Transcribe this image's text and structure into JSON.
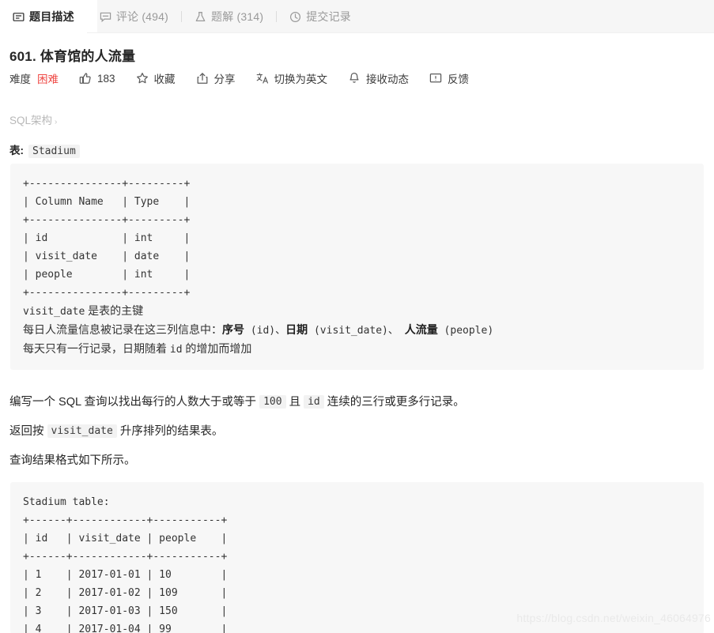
{
  "tabs": [
    {
      "id": "description",
      "label": "题目描述",
      "count": "",
      "icon": "description-icon",
      "active": true
    },
    {
      "id": "comments",
      "label": "评论",
      "count": "(494)",
      "icon": "comment-icon",
      "active": false
    },
    {
      "id": "solutions",
      "label": "题解",
      "count": "(314)",
      "icon": "flask-icon",
      "active": false
    },
    {
      "id": "submissions",
      "label": "提交记录",
      "count": "",
      "icon": "clock-icon",
      "active": false
    }
  ],
  "problem": {
    "title": "601. 体育馆的人流量",
    "difficulty_label": "难度",
    "difficulty_value": "困难",
    "difficulty_color": "#ef4743"
  },
  "meta_actions": [
    {
      "id": "like",
      "icon": "thumbs-up-icon",
      "label": "183"
    },
    {
      "id": "favorite",
      "icon": "star-icon",
      "label": "收藏"
    },
    {
      "id": "share",
      "icon": "share-icon",
      "label": "分享"
    },
    {
      "id": "translate",
      "icon": "translate-icon",
      "label": "切换为英文"
    },
    {
      "id": "subscribe",
      "icon": "bell-icon",
      "label": "接收动态"
    },
    {
      "id": "feedback",
      "icon": "feedback-icon",
      "label": "反馈"
    }
  ],
  "schema_link": {
    "label": "SQL架构",
    "chevron": "›"
  },
  "table_label": {
    "prefix": "表:",
    "name": "Stadium"
  },
  "schema_code": {
    "ascii": "+---------------+---------+\n| Column Name   | Type    |\n+---------------+---------+\n| id            | int     |\n| visit_date    | date    |\n| people        | int     |\n+---------------+---------+",
    "note_primary_key_code": "visit_date",
    "note_primary_key_text": " 是表的主键",
    "note_line2_a": "每日人流量信息被记录在这三列信息中：",
    "note_line2_b1": "序号",
    "note_line2_c1": " (id)、",
    "note_line2_b2": "日期",
    "note_line2_c2": " (visit_date)、 ",
    "note_line2_b3": "人流量",
    "note_line2_c3": " (people)",
    "note_line3_a": "每天只有一行记录，日期随着 ",
    "note_line3_code": "id",
    "note_line3_b": " 的增加而增加"
  },
  "body": {
    "p1_a": "编写一个 SQL 查询以找出每行的人数大于或等于 ",
    "p1_code1": "100",
    "p1_b": " 且 ",
    "p1_code2": "id",
    "p1_c": " 连续的三行或更多行记录。",
    "p2_a": "返回按 ",
    "p2_code": "visit_date",
    "p2_b": " 升序排列的结果表。",
    "p3": "查询结果格式如下所示。"
  },
  "example_code": {
    "ascii": "Stadium table:\n+------+------------+-----------+\n| id   | visit_date | people    |\n+------+------------+-----------+\n| 1    | 2017-01-01 | 10        |\n| 2    | 2017-01-02 | 109       |\n| 3    | 2017-01-03 | 150       |\n| 4    | 2017-01-04 | 99        |"
  },
  "watermark": "https://blog.csdn.net/weixin_46064976"
}
